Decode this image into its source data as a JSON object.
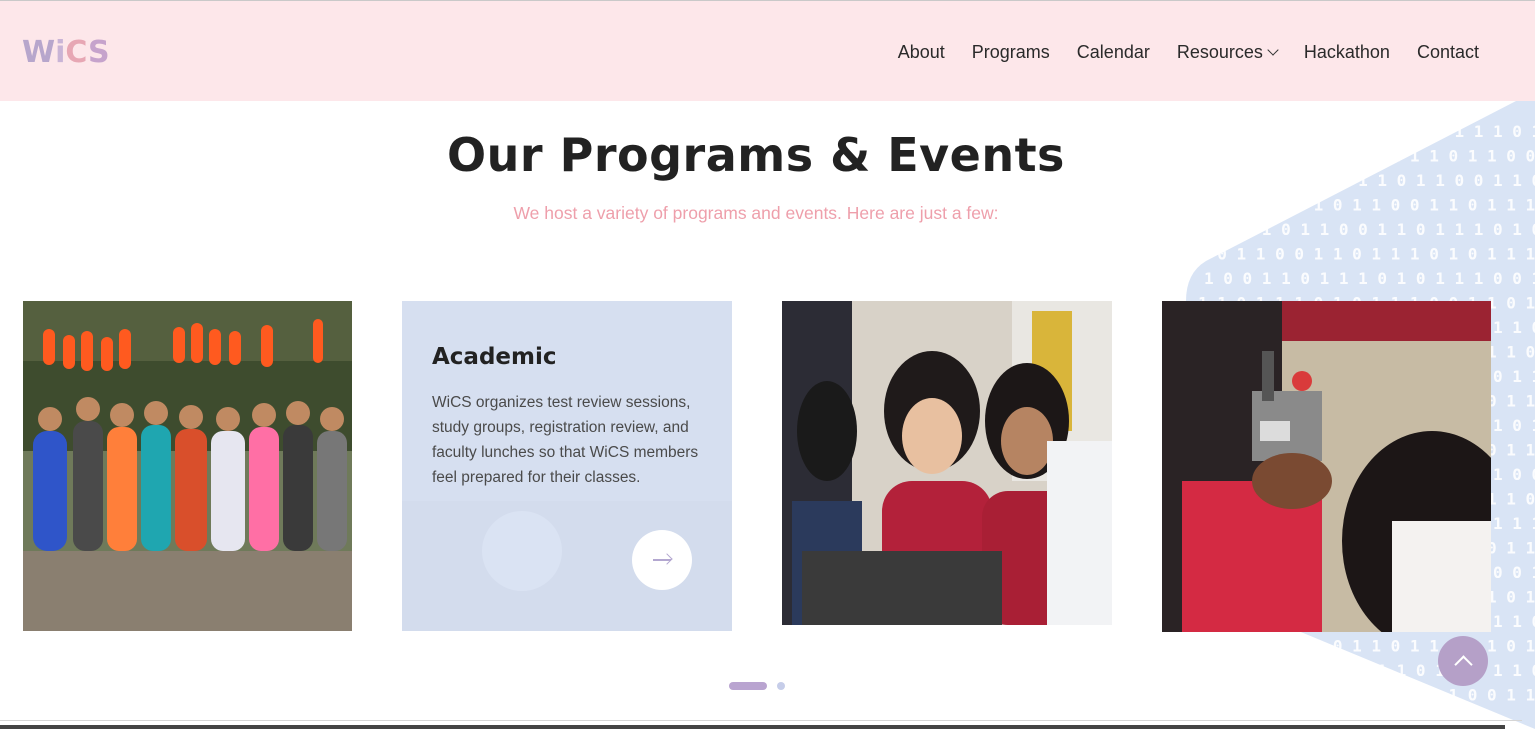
{
  "header": {
    "logo": [
      "W",
      "i",
      "C",
      "S"
    ],
    "nav": [
      {
        "label": "About"
      },
      {
        "label": "Programs"
      },
      {
        "label": "Calendar"
      },
      {
        "label": "Resources",
        "has_dropdown": true
      },
      {
        "label": "Hackathon"
      },
      {
        "label": "Contact"
      }
    ]
  },
  "main": {
    "title": "Our Programs & Events",
    "subtitle": "We host a variety of programs and events. Here are just a few:"
  },
  "cards": [
    {
      "kind": "photo",
      "description": "group-kayak-paddles-photo"
    },
    {
      "kind": "text",
      "title": "Academic",
      "text": "WiCS organizes test review sessions, study groups, registration review, and faculty lunches so that WiCS members feel prepared for their classes.",
      "icon": "arrow-right-icon"
    },
    {
      "kind": "photo",
      "description": "students-at-computer-photo"
    },
    {
      "kind": "photo",
      "description": "robot-kit-photo"
    }
  ],
  "pagination": {
    "total": 2,
    "active": 1
  },
  "colors": {
    "header_bg": "#fde7ea",
    "subtitle": "#ee9fab",
    "accent_purple": "#b5a0c8",
    "binary_panel": "#d9e4f5"
  },
  "back_to_top": {
    "icon": "chevron-up-icon"
  }
}
